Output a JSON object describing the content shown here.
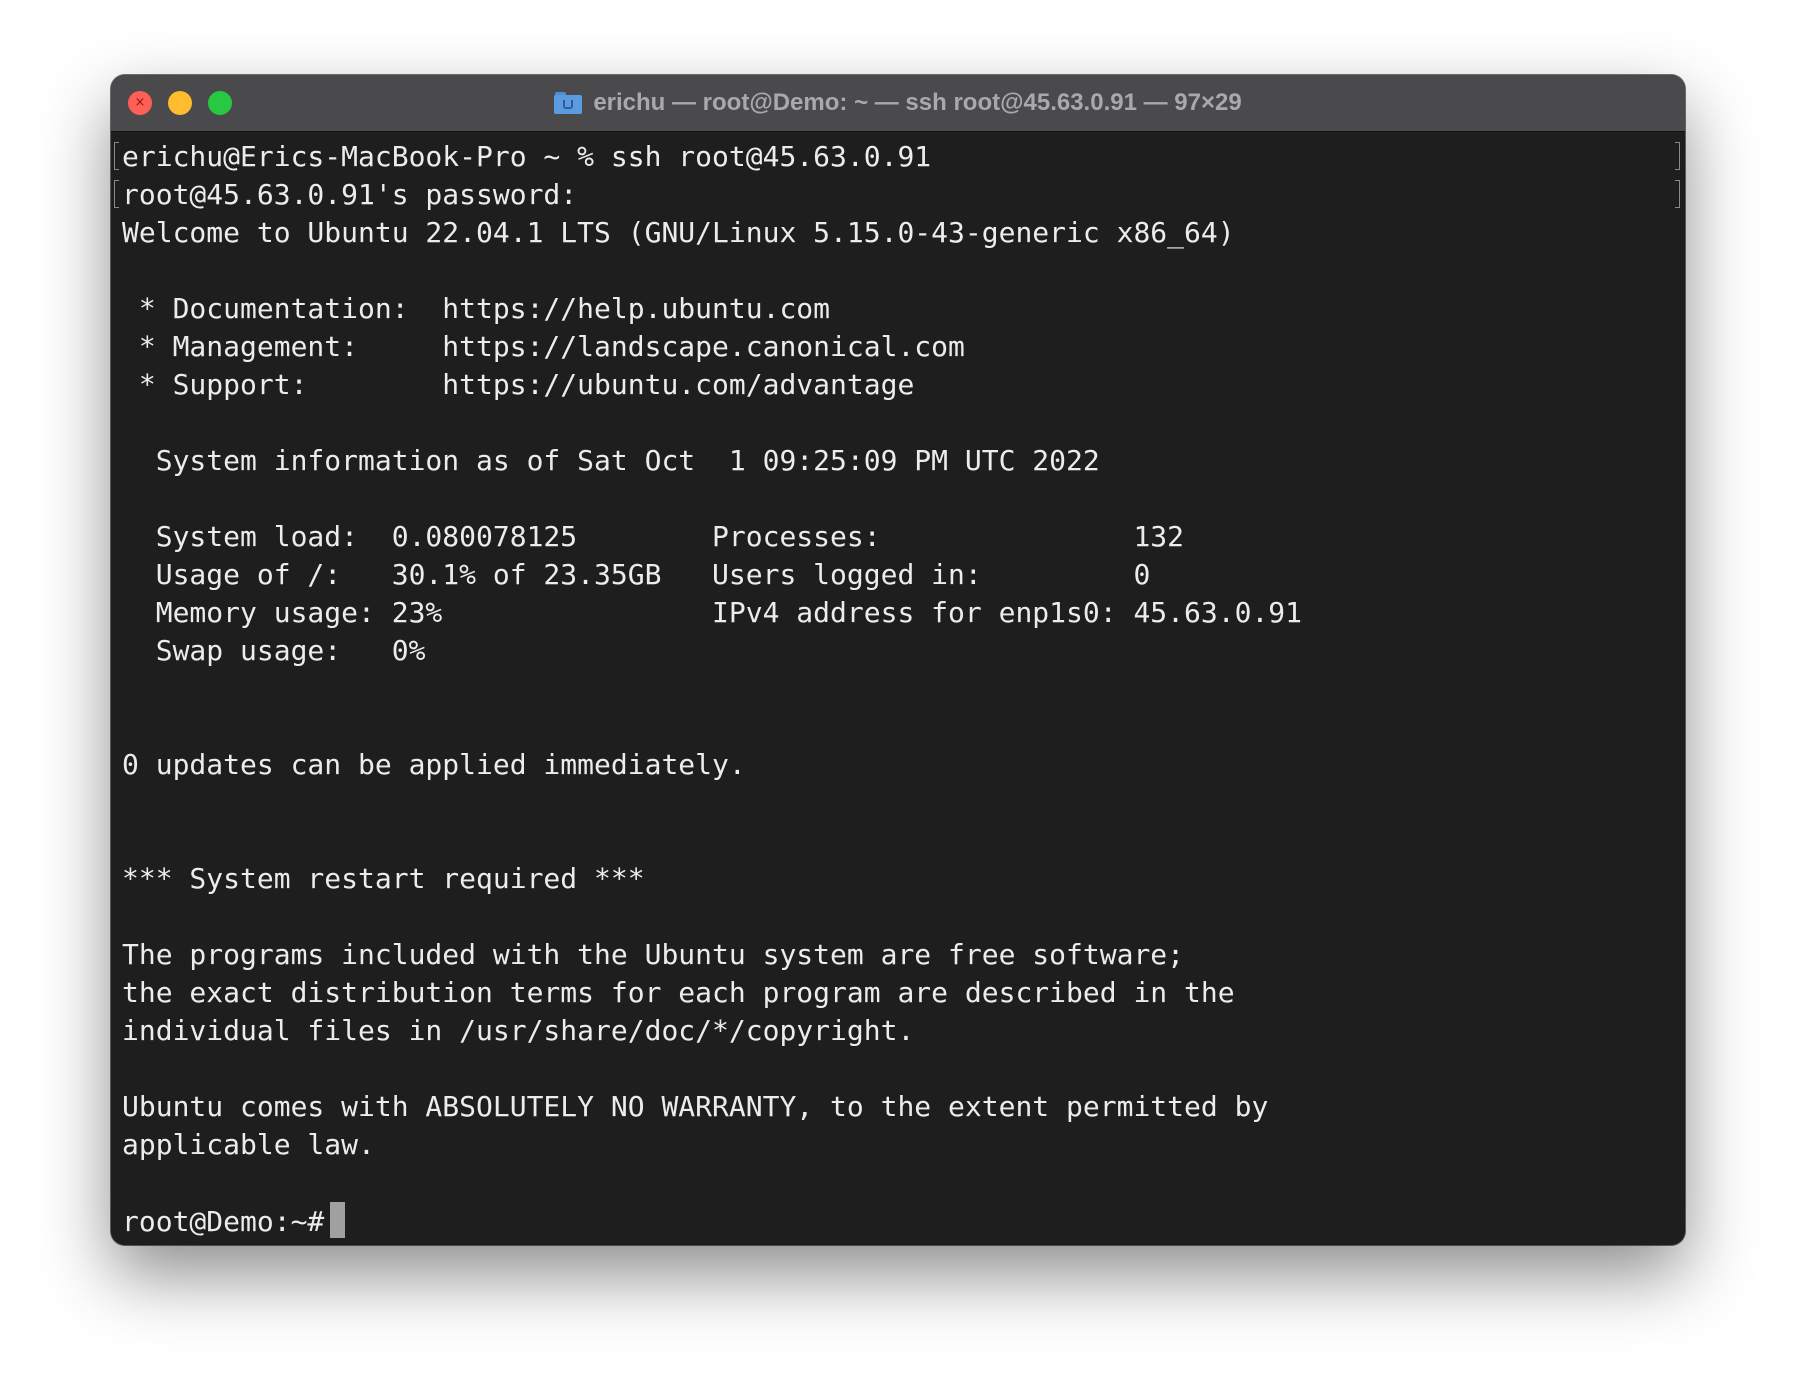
{
  "window": {
    "title": "erichu — root@Demo: ~ — ssh root@45.63.0.91 — 97×29",
    "title_icon": "folder-home-icon",
    "traffic_lights": {
      "close": "#ff5f57",
      "minimize": "#febc2e",
      "maximize": "#28c840"
    }
  },
  "terminal": {
    "background": "#1e1e1e",
    "foreground": "#ececec",
    "lines": [
      "erichu@Erics-MacBook-Pro ~ % ssh root@45.63.0.91",
      "root@45.63.0.91's password:",
      "Welcome to Ubuntu 22.04.1 LTS (GNU/Linux 5.15.0-43-generic x86_64)",
      "",
      " * Documentation:  https://help.ubuntu.com",
      " * Management:     https://landscape.canonical.com",
      " * Support:        https://ubuntu.com/advantage",
      "",
      "  System information as of Sat Oct  1 09:25:09 PM UTC 2022",
      "",
      "  System load:  0.080078125        Processes:               132",
      "  Usage of /:   30.1% of 23.35GB   Users logged in:         0",
      "  Memory usage: 23%                IPv4 address for enp1s0: 45.63.0.91",
      "  Swap usage:   0%",
      "",
      "",
      "0 updates can be applied immediately.",
      "",
      "",
      "*** System restart required ***",
      "",
      "The programs included with the Ubuntu system are free software;",
      "the exact distribution terms for each program are described in the",
      "individual files in /usr/share/doc/*/copyright.",
      "",
      "Ubuntu comes with ABSOLUTELY NO WARRANTY, to the extent permitted by",
      "applicable law.",
      ""
    ],
    "prompt": "root@Demo:~#"
  }
}
